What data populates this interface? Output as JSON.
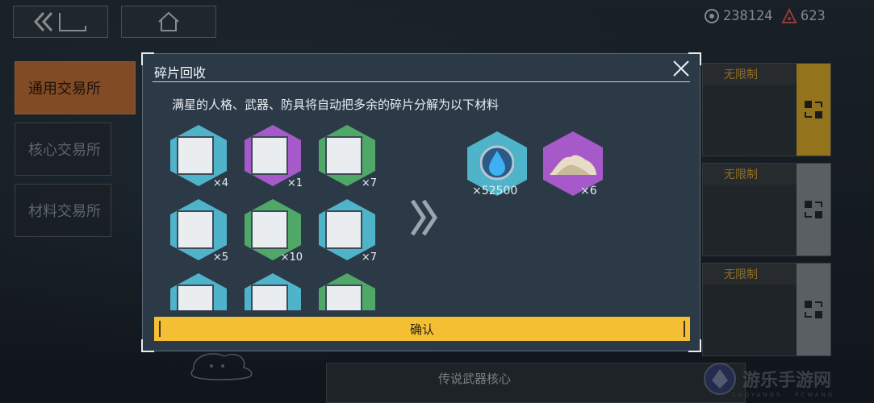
{
  "topbar": {
    "back_icon": "double-chevron-left-icon",
    "home_icon": "home-icon",
    "currency_a": "238124",
    "currency_b": "623"
  },
  "sidebar": {
    "items": [
      {
        "label": "通用交易所",
        "active": true
      },
      {
        "label": "核心交易所",
        "active": false
      },
      {
        "label": "材料交易所",
        "active": false
      }
    ]
  },
  "cards": [
    {
      "label": "无限制"
    },
    {
      "label": "无限制"
    },
    {
      "label": "无限制"
    }
  ],
  "bottom_card": {
    "label": "传说武器核心"
  },
  "watermark": {
    "text": "游乐手游网",
    "sub": "LUOYANGS · PCWANG"
  },
  "modal": {
    "title": "碎片回收",
    "description": "满星的人格、武器、防具将自动把多余的碎片分解为以下材料",
    "items": [
      {
        "count": "×4",
        "color": "#4fb3c9"
      },
      {
        "count": "×1",
        "color": "#a65ac9"
      },
      {
        "count": "×7",
        "color": "#4fa868"
      },
      {
        "count": "×5",
        "color": "#4fb3c9"
      },
      {
        "count": "×10",
        "color": "#4fa868"
      },
      {
        "count": "×7",
        "color": "#4fb3c9"
      },
      {
        "count": "",
        "color": "#4fb3c9"
      },
      {
        "count": "",
        "color": "#4fb3c9"
      },
      {
        "count": "",
        "color": "#4fa868"
      }
    ],
    "rewards": [
      {
        "count": "×52500",
        "color": "#4fb3c9",
        "icon": "water-drop-icon"
      },
      {
        "count": "×6",
        "color": "#a65ac9",
        "icon": "sand-pile-icon"
      }
    ],
    "confirm_label": "确认"
  },
  "colors": {
    "accent_orange": "#c5733a",
    "confirm_yellow": "#f5bf33",
    "card_label_gold": "#d6a93a"
  }
}
